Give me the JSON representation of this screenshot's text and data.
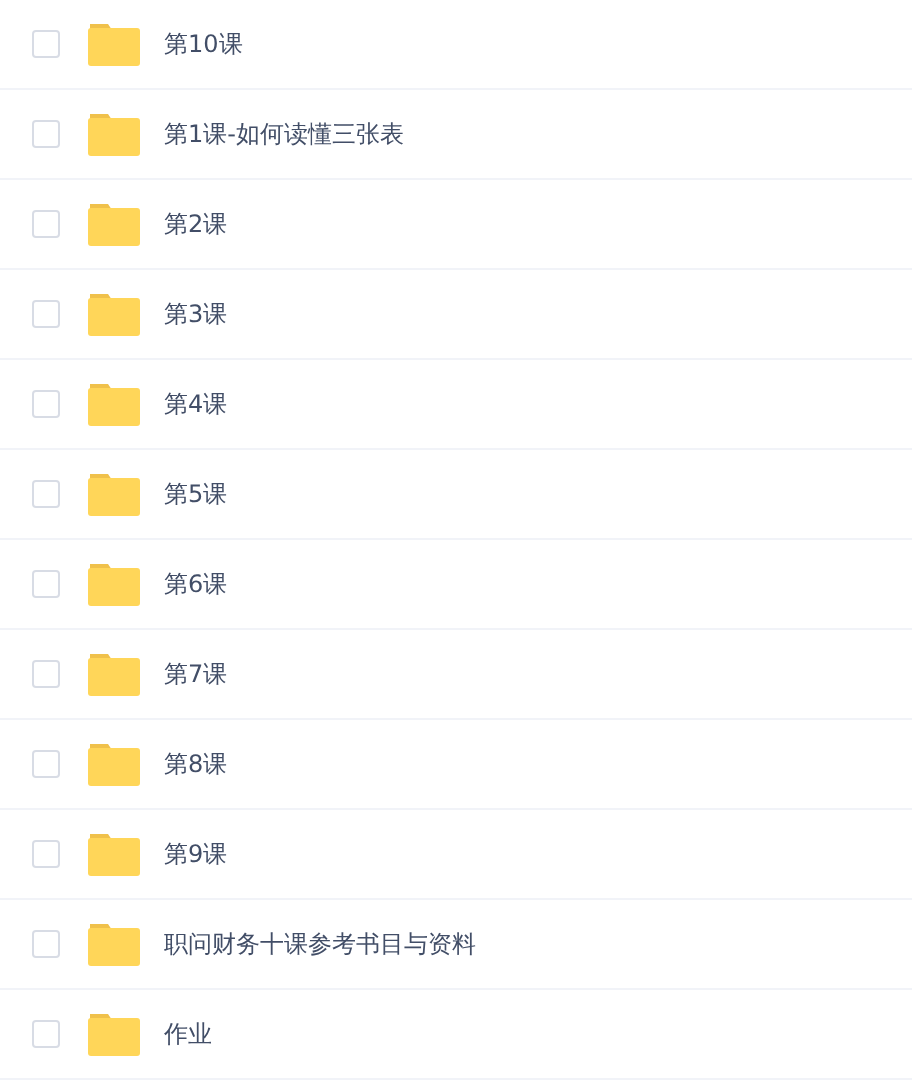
{
  "files": [
    {
      "name": "第10课",
      "checked": false
    },
    {
      "name": "第1课-如何读懂三张表",
      "checked": false
    },
    {
      "name": "第2课",
      "checked": false
    },
    {
      "name": "第3课",
      "checked": false
    },
    {
      "name": "第4课",
      "checked": false
    },
    {
      "name": "第5课",
      "checked": false
    },
    {
      "name": "第6课",
      "checked": false
    },
    {
      "name": "第7课",
      "checked": false
    },
    {
      "name": "第8课",
      "checked": false
    },
    {
      "name": "第9课",
      "checked": false
    },
    {
      "name": "职问财务十课参考书目与资料",
      "checked": false
    },
    {
      "name": "作业",
      "checked": false
    }
  ]
}
